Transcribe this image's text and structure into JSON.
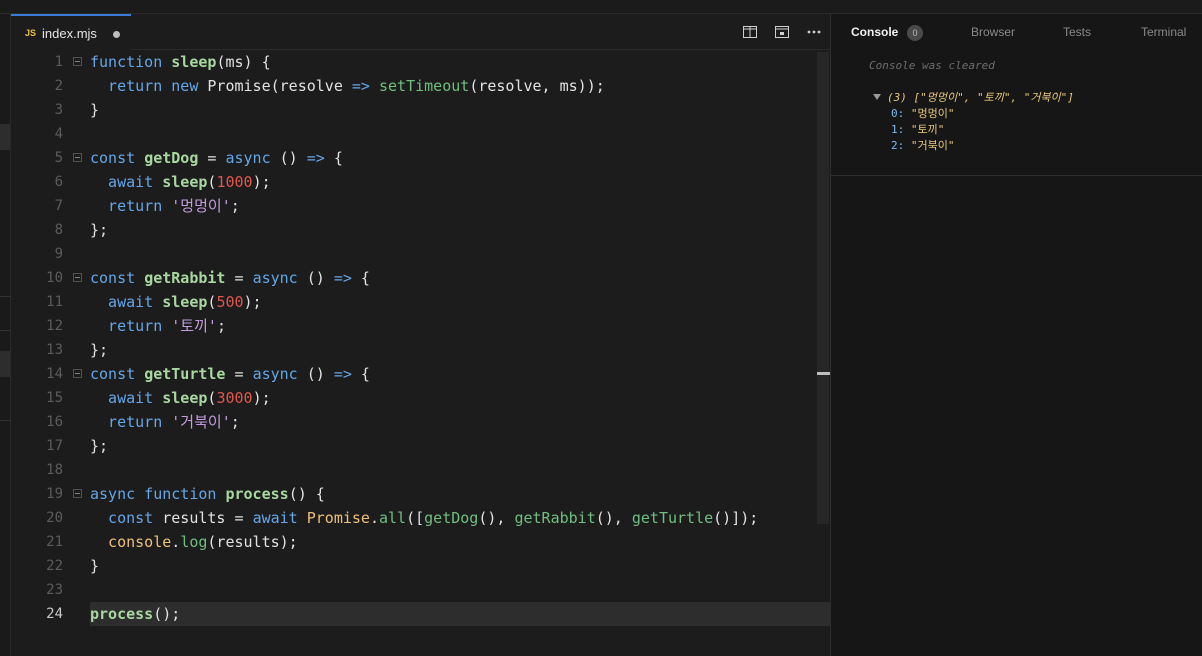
{
  "editor": {
    "tab_label": "index.mjs",
    "file_icon": "JS",
    "actions": [
      "split-editor-icon",
      "preview-icon",
      "more-icon"
    ],
    "lines": [
      {
        "n": "1",
        "tokens": [
          [
            "k",
            "function "
          ],
          [
            "fn",
            "sleep"
          ],
          [
            "p",
            "(ms) {"
          ]
        ]
      },
      {
        "n": "2",
        "tokens": [
          [
            "k",
            "  return new "
          ],
          [
            "p",
            "Promise(resolve "
          ],
          [
            "ar",
            "=>"
          ],
          [
            "p",
            " "
          ],
          [
            "fnc",
            "setTimeout"
          ],
          [
            "p",
            "(resolve, ms));"
          ]
        ]
      },
      {
        "n": "3",
        "tokens": [
          [
            "p",
            "}"
          ]
        ]
      },
      {
        "n": "4",
        "tokens": []
      },
      {
        "n": "5",
        "tokens": [
          [
            "k",
            "const "
          ],
          [
            "fn",
            "getDog"
          ],
          [
            "p",
            " = "
          ],
          [
            "k",
            "async"
          ],
          [
            "p",
            " () "
          ],
          [
            "ar",
            "=>"
          ],
          [
            "p",
            " {"
          ]
        ]
      },
      {
        "n": "6",
        "tokens": [
          [
            "k",
            "  await "
          ],
          [
            "fn",
            "sleep"
          ],
          [
            "p",
            "("
          ],
          [
            "n",
            "1000"
          ],
          [
            "p",
            ");"
          ]
        ]
      },
      {
        "n": "7",
        "tokens": [
          [
            "k",
            "  return "
          ],
          [
            "s",
            "'멍멍이'"
          ],
          [
            "p",
            ";"
          ]
        ]
      },
      {
        "n": "8",
        "tokens": [
          [
            "p",
            "};"
          ]
        ]
      },
      {
        "n": "9",
        "tokens": []
      },
      {
        "n": "10",
        "tokens": [
          [
            "k",
            "const "
          ],
          [
            "fn",
            "getRabbit"
          ],
          [
            "p",
            " = "
          ],
          [
            "k",
            "async"
          ],
          [
            "p",
            " () "
          ],
          [
            "ar",
            "=>"
          ],
          [
            "p",
            " {"
          ]
        ]
      },
      {
        "n": "11",
        "tokens": [
          [
            "k",
            "  await "
          ],
          [
            "fn",
            "sleep"
          ],
          [
            "p",
            "("
          ],
          [
            "n",
            "500"
          ],
          [
            "p",
            ");"
          ]
        ]
      },
      {
        "n": "12",
        "tokens": [
          [
            "k",
            "  return "
          ],
          [
            "s",
            "'토끼'"
          ],
          [
            "p",
            ";"
          ]
        ]
      },
      {
        "n": "13",
        "tokens": [
          [
            "p",
            "};"
          ]
        ]
      },
      {
        "n": "14",
        "tokens": [
          [
            "k",
            "const "
          ],
          [
            "fn",
            "getTurtle"
          ],
          [
            "p",
            " = "
          ],
          [
            "k",
            "async"
          ],
          [
            "p",
            " () "
          ],
          [
            "ar",
            "=>"
          ],
          [
            "p",
            " {"
          ]
        ]
      },
      {
        "n": "15",
        "tokens": [
          [
            "k",
            "  await "
          ],
          [
            "fn",
            "sleep"
          ],
          [
            "p",
            "("
          ],
          [
            "n",
            "3000"
          ],
          [
            "p",
            ");"
          ]
        ]
      },
      {
        "n": "16",
        "tokens": [
          [
            "k",
            "  return "
          ],
          [
            "s",
            "'거북이'"
          ],
          [
            "p",
            ";"
          ]
        ]
      },
      {
        "n": "17",
        "tokens": [
          [
            "p",
            "};"
          ]
        ]
      },
      {
        "n": "18",
        "tokens": []
      },
      {
        "n": "19",
        "tokens": [
          [
            "k",
            "async function "
          ],
          [
            "fn",
            "process"
          ],
          [
            "p",
            "() {"
          ]
        ]
      },
      {
        "n": "20",
        "tokens": [
          [
            "k",
            "  const "
          ],
          [
            "p",
            "results = "
          ],
          [
            "k",
            "await "
          ],
          [
            "cls",
            "Promise"
          ],
          [
            "p",
            "."
          ],
          [
            "fnc",
            "all"
          ],
          [
            "p",
            "(["
          ],
          [
            "fnc",
            "getDog"
          ],
          [
            "p",
            "(), "
          ],
          [
            "fnc",
            "getRabbit"
          ],
          [
            "p",
            "(), "
          ],
          [
            "fnc",
            "getTurtle"
          ],
          [
            "p",
            "()]);"
          ]
        ]
      },
      {
        "n": "21",
        "tokens": [
          [
            "cls",
            "  console"
          ],
          [
            "p",
            "."
          ],
          [
            "fnc",
            "log"
          ],
          [
            "p",
            "(results);"
          ]
        ]
      },
      {
        "n": "22",
        "tokens": [
          [
            "p",
            "}"
          ]
        ]
      },
      {
        "n": "23",
        "tokens": []
      },
      {
        "n": "24",
        "tokens": [
          [
            "fn",
            "process"
          ],
          [
            "p",
            "();"
          ]
        ]
      }
    ],
    "fold_lines": [
      "1",
      "5",
      "10",
      "14",
      "19"
    ],
    "active_line": "24"
  },
  "panel": {
    "tabs": [
      "Console",
      "Browser",
      "Tests",
      "Terminal"
    ],
    "badge": "0",
    "cleared_text": "Console was cleared",
    "log_header": "(3) [\"멍멍이\", \"토끼\", \"거북이\"]",
    "items": [
      {
        "key": "0:",
        "value": "\"멍멍이\""
      },
      {
        "key": "1:",
        "value": "\"토끼\""
      },
      {
        "key": "2:",
        "value": "\"거북이\""
      }
    ]
  },
  "colors": {
    "keyword": "#64a7e8",
    "function": "#a8d8a0",
    "number": "#e0574c",
    "string": "#c49bdf",
    "class": "#efc07b",
    "accent": "#3d7bd9"
  }
}
